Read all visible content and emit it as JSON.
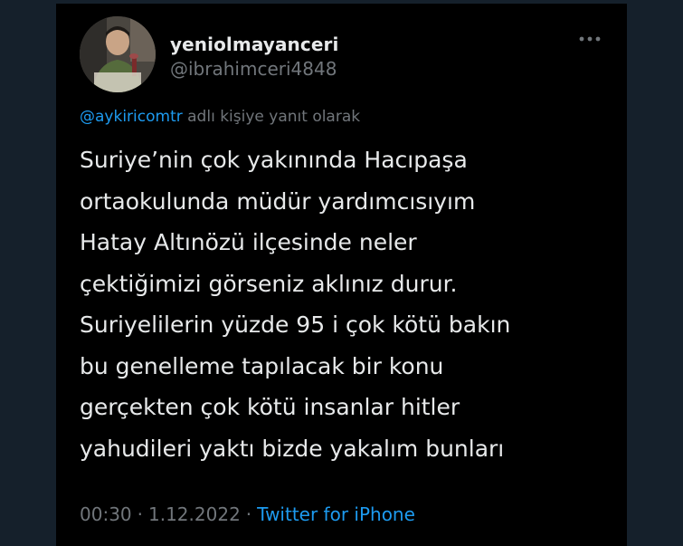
{
  "tweet": {
    "author": {
      "display_name": "yeniolmayanceri",
      "handle": "@ibrahimceri4848",
      "avatar": "profile-photo"
    },
    "reply_to": {
      "mention": "@aykiricomtr",
      "suffix": " adlı kişiye yanıt olarak"
    },
    "text_lines": [
      "Suriye’nin çok yakınında Hacıpaşa",
      "ortaokulunda müdür yardımcısıyım",
      "Hatay Altınözü ilçesinde neler",
      "çektiğimizi görseniz aklınız durur.",
      "Suriyelilerin yüzde 95 i çok kötü bakın",
      "bu genelleme tapılacak bir konu",
      "gerçekten çok kötü insanlar hitler",
      "yahudileri yaktı bizde yakalım bunları"
    ],
    "time": "00:30",
    "separator": "·",
    "date": "1.12.2022",
    "source": "Twitter for iPhone"
  },
  "icons": {
    "more": "more-dots-icon"
  },
  "colors": {
    "background": "#15202b",
    "card": "#000000",
    "text": "#e7e9ea",
    "muted": "#71767b",
    "link": "#1d9bf0"
  }
}
